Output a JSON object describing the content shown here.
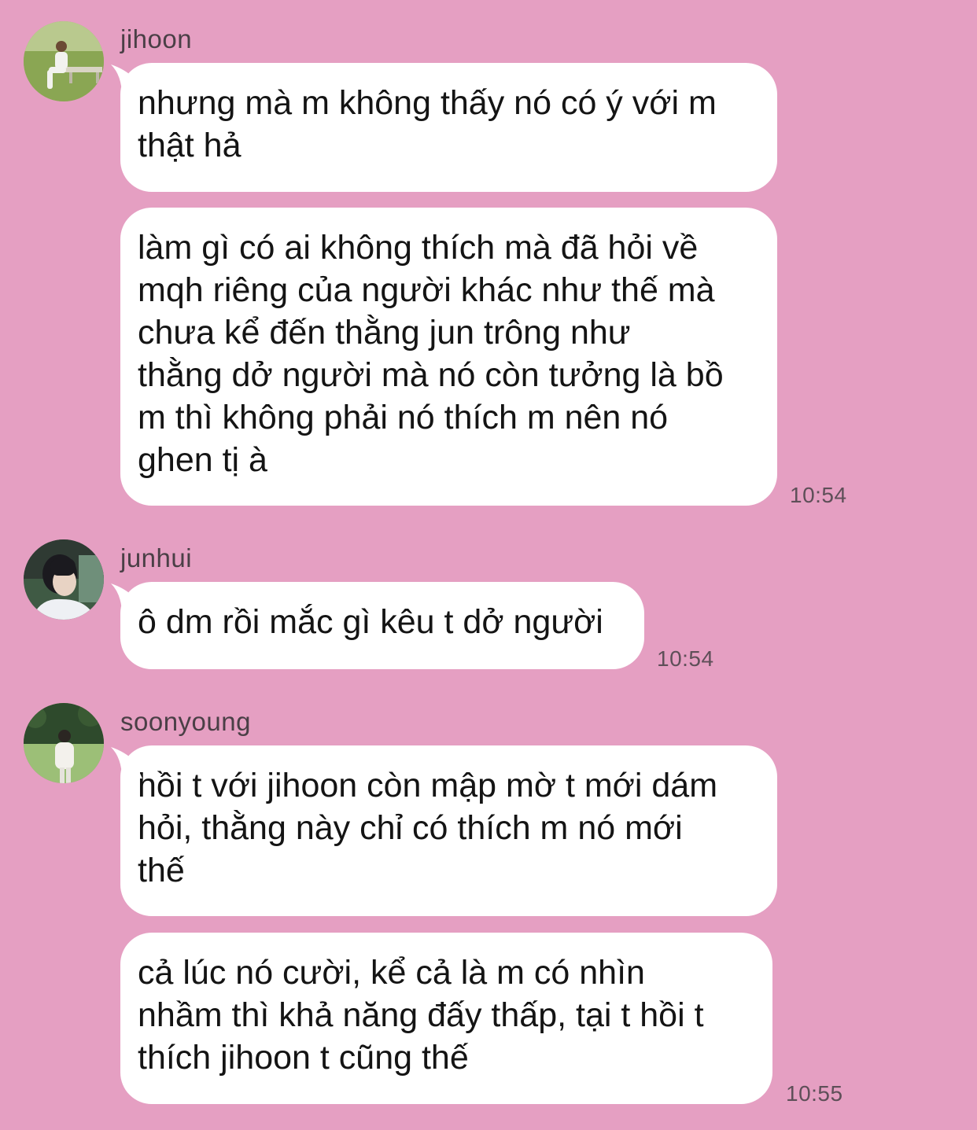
{
  "groups": [
    {
      "sender": "jihoon",
      "avatar_icon": "profile-photo-person-sitting-on-bench-in-park",
      "messages": [
        {
          "lines": [
            "nhưng mà m không thấy nó có ý với m",
            "thật hả"
          ]
        },
        {
          "lines": [
            "làm gì có ai không thích mà đã hỏi về",
            "mqh riêng của người khác như thế mà",
            "chưa kể đến thằng jun trông như",
            "thằng dở người mà nó còn tưởng là bồ",
            "m thì không phải nó thích m nên nó",
            "ghen tị à"
          ]
        }
      ],
      "time": "10:54"
    },
    {
      "sender": "junhui",
      "avatar_icon": "profile-photo-dark-haired-person-side-profile",
      "messages": [
        {
          "lines": [
            "ô dm rồi mắc gì kêu t dở người"
          ]
        }
      ],
      "time": "10:54"
    },
    {
      "sender": "soonyoung",
      "avatar_icon": "profile-photo-person-in-white-shirt-in-forest",
      "messages": [
        {
          "lines": [
            "hồi t với jihoon còn mập mờ t mới dám",
            "hỏi, thằng này chỉ có thích m nó mới",
            "thế"
          ]
        },
        {
          "lines": [
            "cả lúc nó cười, kể cả là m có nhìn",
            "nhầm thì khả năng đấy thấp, tại t hồi t",
            "thích jihoon t cũng thế"
          ]
        }
      ],
      "time": "10:55"
    }
  ],
  "colors": {
    "chat_background": "#e59fc2",
    "bubble_background": "#ffffff",
    "text": "#141414",
    "meta_text": "#5e4f58"
  }
}
